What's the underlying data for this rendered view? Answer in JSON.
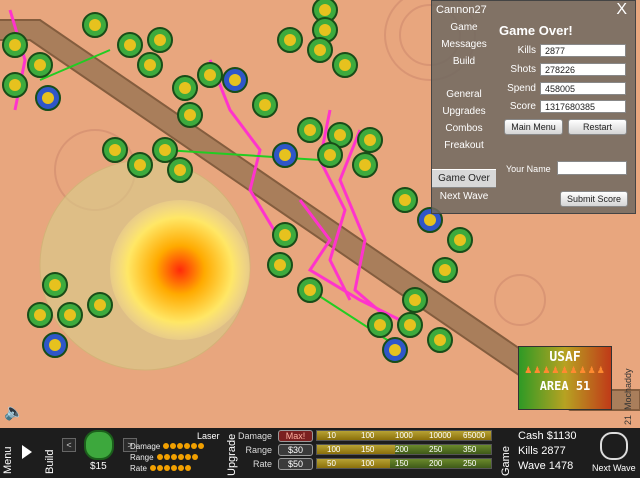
{
  "panel": {
    "title": "Cannon27",
    "close": "X",
    "menu": [
      "Game",
      "Messages",
      "Build",
      "General",
      "Upgrades",
      "Combos",
      "Freakout"
    ],
    "menu_game_over": "Game Over",
    "menu_next_wave": "Next Wave",
    "heading": "Game Over!",
    "stats": [
      {
        "label": "Kills",
        "value": "2877"
      },
      {
        "label": "Shots",
        "value": "278226"
      },
      {
        "label": "Spend",
        "value": "458005"
      },
      {
        "label": "Score",
        "value": "1317680385"
      }
    ],
    "main_menu": "Main Menu",
    "restart": "Restart",
    "your_name_label": "Your Name",
    "your_name_value": "",
    "submit": "Submit Score"
  },
  "sign": {
    "line1": "USAF",
    "line2": "AREA 51"
  },
  "side_text": {
    "wave_num": "21",
    "credit": "Mochaddy"
  },
  "hud": {
    "menu": "Menu",
    "build": "Build",
    "price": "$15",
    "tower_type": "Laser",
    "rows": [
      {
        "label": "Damage",
        "dots": 6
      },
      {
        "label": "Range",
        "dots": 6
      },
      {
        "label": "Rate",
        "dots": 6
      }
    ],
    "upgrade": "Upgrade",
    "upgrades": [
      {
        "label": "Damage",
        "button": "Max!",
        "ticks": [
          "10",
          "100",
          "1000",
          "10000",
          "65000"
        ],
        "level": 1.0
      },
      {
        "label": "Range",
        "button": "$30",
        "ticks": [
          "100",
          "150",
          "200",
          "250",
          "350"
        ],
        "level": 0.45
      },
      {
        "label": "Rate",
        "button": "$50",
        "ticks": [
          "50",
          "100",
          "150",
          "200",
          "250"
        ],
        "level": 0.42
      }
    ],
    "game": "Game",
    "cash": "Cash $1130",
    "kills": "Kills 2877",
    "wave": "Wave 1478",
    "next_wave": "Next Wave"
  },
  "colors": {
    "path": "#a37a58",
    "laser_beam": "#ff33cc",
    "green_beam": "#22cc22",
    "panel": "#6e6860",
    "hud": "#1d1d1d"
  }
}
